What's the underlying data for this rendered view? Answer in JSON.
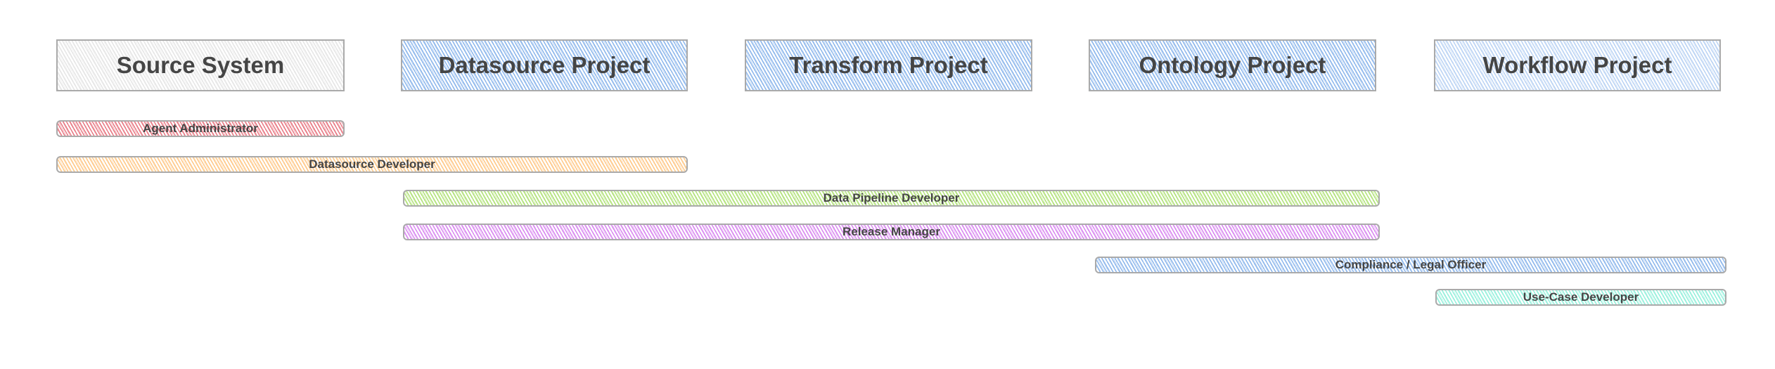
{
  "columns": [
    {
      "label": "Source System",
      "color": "#e6e6e6"
    },
    {
      "label": "Datasource Project",
      "color": "#8fb8ec"
    },
    {
      "label": "Transform Project",
      "color": "#8fb8ec"
    },
    {
      "label": "Ontology Project",
      "color": "#8fb8ec"
    },
    {
      "label": "Workflow Project",
      "color": "#bcd4f4"
    }
  ],
  "roles": [
    {
      "label": "Agent Administrator",
      "color": "#e87b86",
      "spans": [
        "Source System"
      ]
    },
    {
      "label": "Datasource Developer",
      "color": "#ffc98a",
      "spans": [
        "Source System",
        "Datasource Project"
      ]
    },
    {
      "label": "Data Pipeline Developer",
      "color": "#b2e27a",
      "spans": [
        "Datasource Project",
        "Transform Project",
        "Ontology Project"
      ]
    },
    {
      "label": "Release Manager",
      "color": "#d98af0",
      "spans": [
        "Datasource Project",
        "Transform Project",
        "Ontology Project"
      ]
    },
    {
      "label": "Compliance / Legal Officer",
      "color": "#8fb8ec",
      "spans": [
        "Ontology Project",
        "Workflow Project"
      ]
    },
    {
      "label": "Use-Case Developer",
      "color": "#96f0dc",
      "spans": [
        "Workflow Project"
      ]
    }
  ]
}
